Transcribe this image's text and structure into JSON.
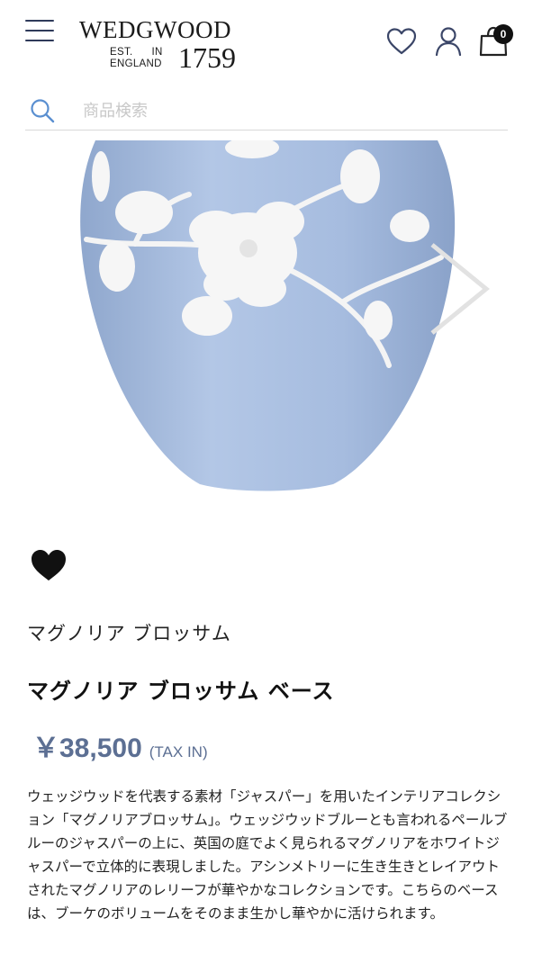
{
  "header": {
    "logo": {
      "name": "WEDGWOOD",
      "est_line1": "EST.      IN",
      "est_line2": "ENGLAND",
      "year": "1759"
    },
    "cart_count": "0",
    "icons": {
      "menu": "hamburger-menu-icon",
      "wishlist": "heart-outline-icon",
      "account": "user-icon",
      "cart": "shopping-bag-icon"
    }
  },
  "search": {
    "placeholder": "商品検索",
    "value": ""
  },
  "gallery": {
    "image": "blue-jasper-vase-with-white-magnolia-relief",
    "next_icon": "chevron-right-icon"
  },
  "product": {
    "collection": "マグノリア ブロッサム",
    "title": "マグノリア ブロッサム ベース",
    "price": "￥38,500",
    "tax_label": "(TAX IN)",
    "favorite_icon": "heart-filled-icon",
    "description": "ウェッジウッドを代表する素材「ジャスパー」を用いたインテリアコレクション「マグノリアブロッサム」。ウェッジウッドブルーとも言われるペールブルーのジャスパーの上に、英国の庭でよく見られるマグノリアをホワイトジャスパーで立体的に表現しました。アシンメトリーに生き生きとレイアウトされたマグノリアのレリーフが華やかなコレクションです。こちらのベースは、ブーケのボリュームをそのまま生かし華やかに活けられます。"
  },
  "colors": {
    "accent": "#5c6f93",
    "vase": "#a9bedf",
    "nav": "#2f3a5a"
  }
}
